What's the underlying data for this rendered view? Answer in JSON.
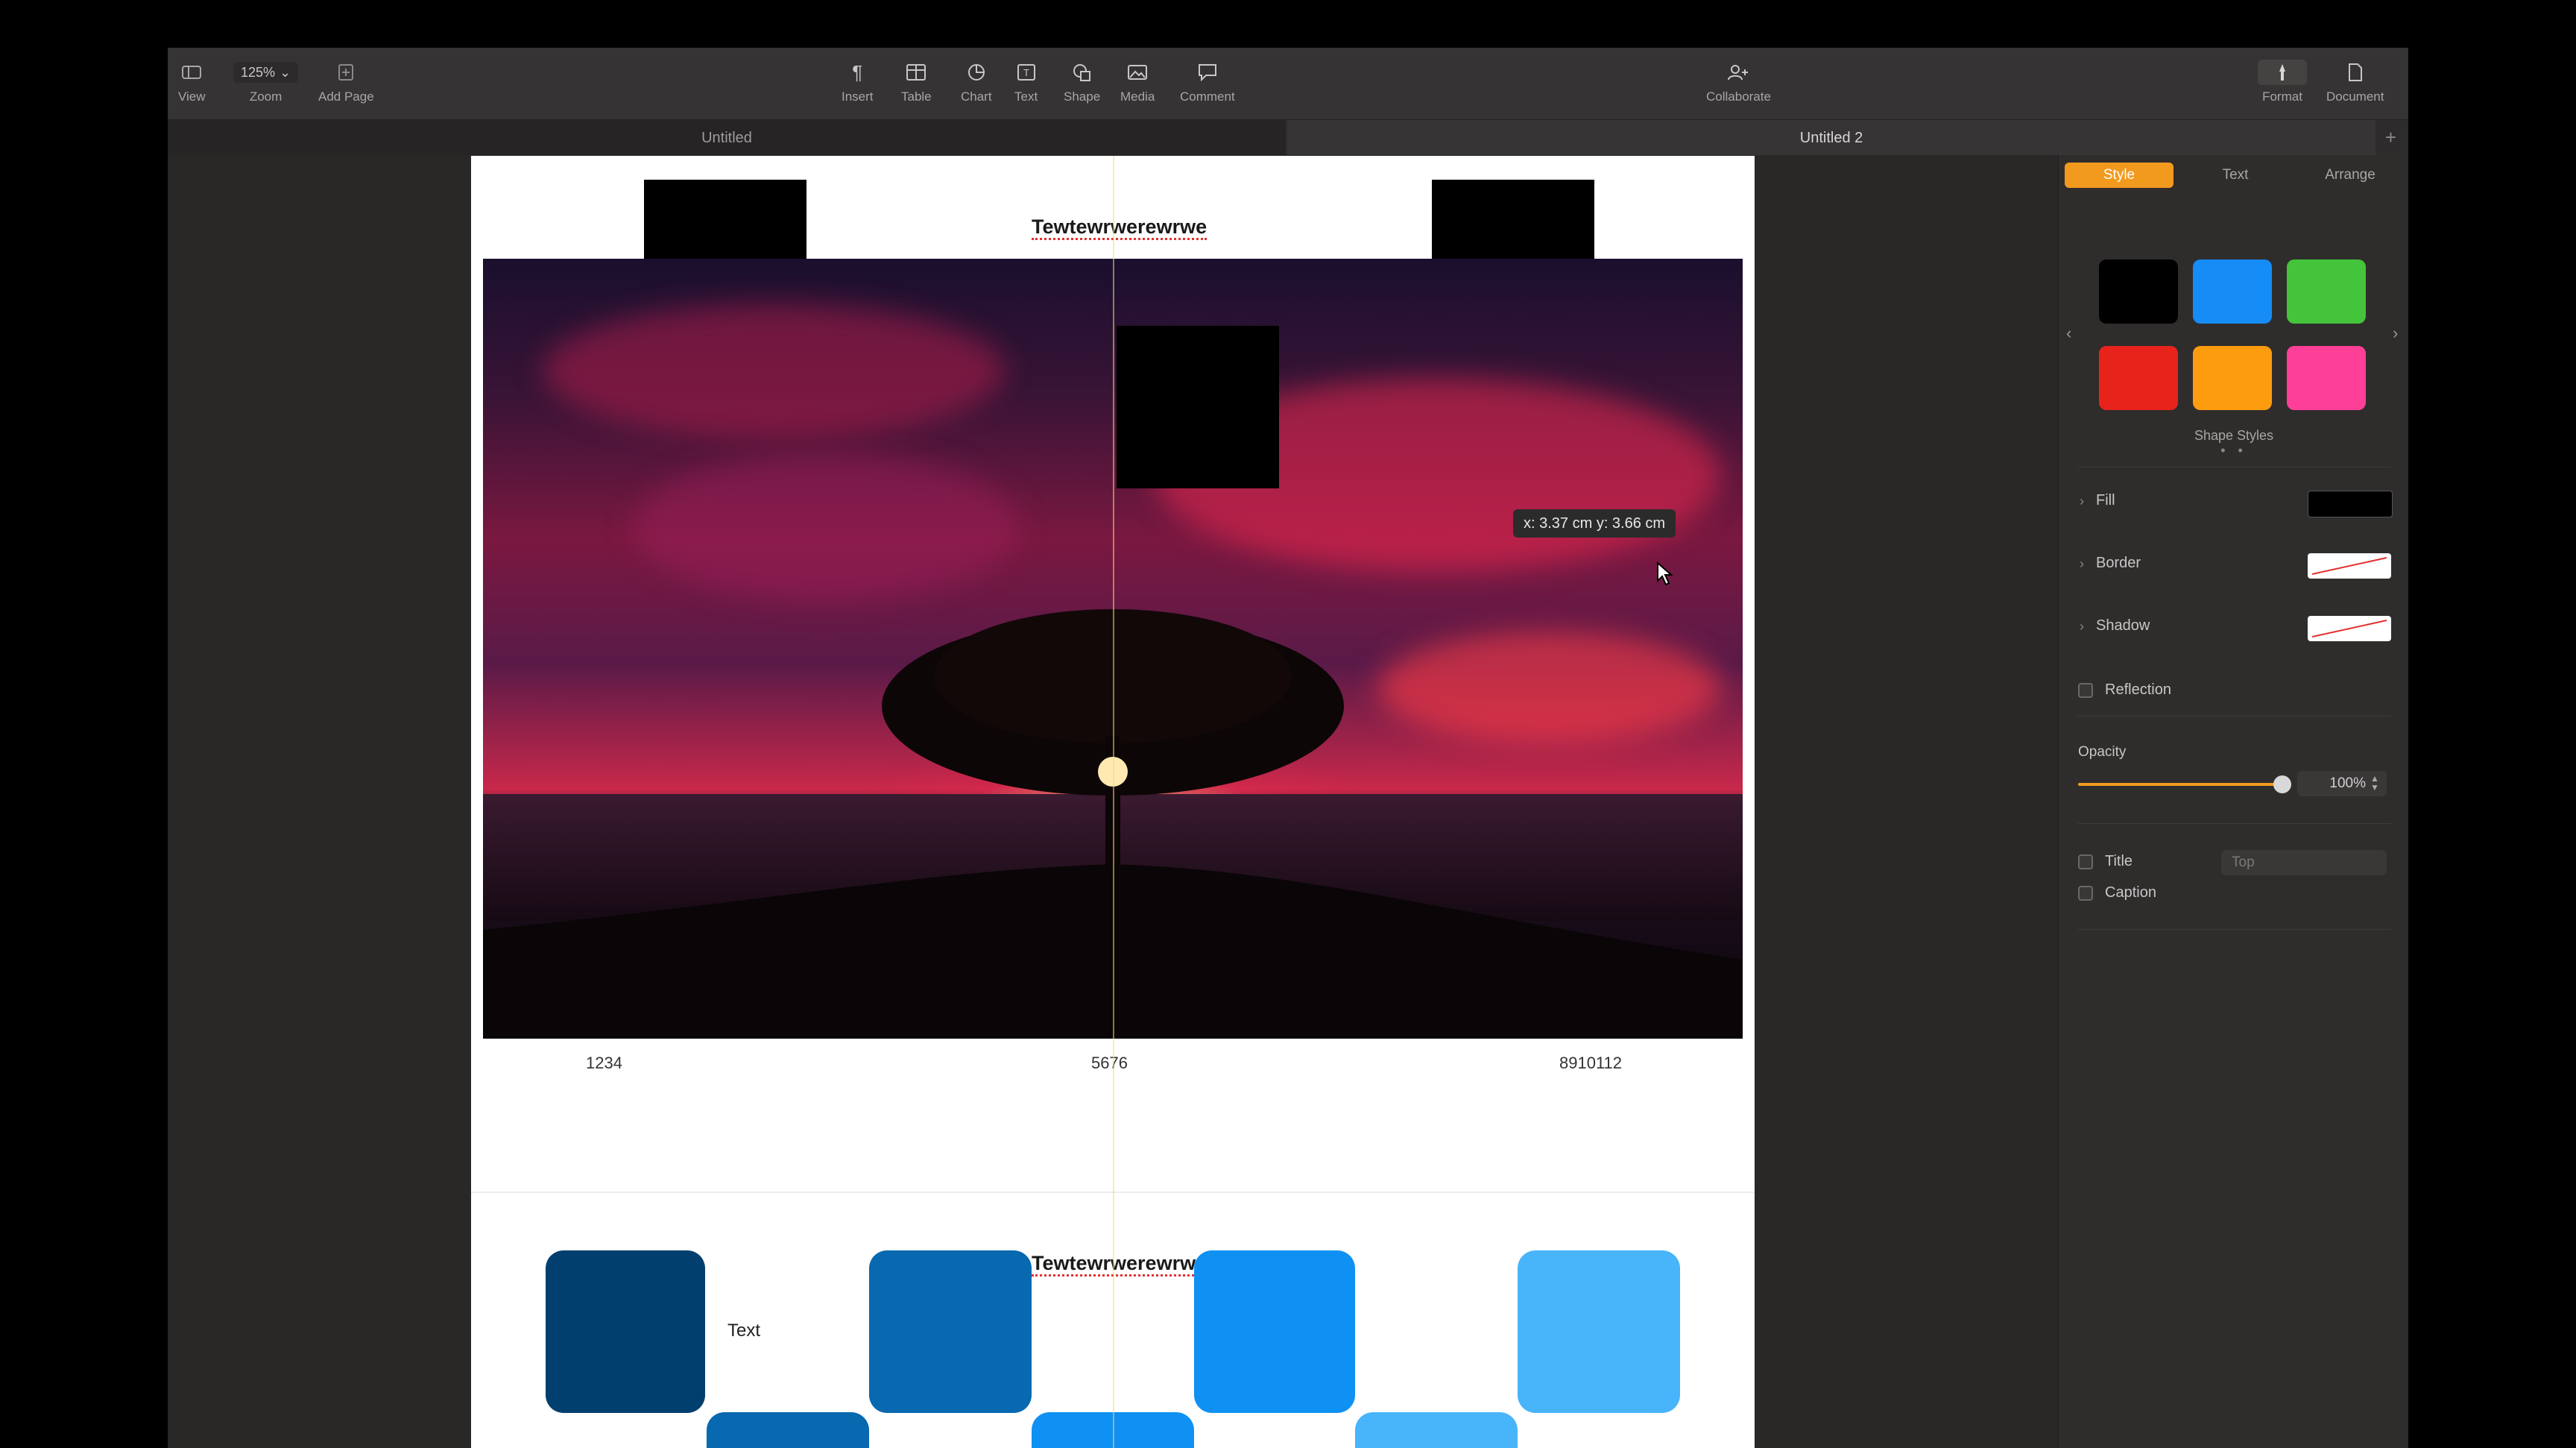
{
  "toolbar": {
    "view": {
      "label": "View",
      "icon": "sidebar-icon"
    },
    "zoom": {
      "value": "125%",
      "label": "Zoom"
    },
    "add_page": {
      "label": "Add Page",
      "icon": "add-page-icon"
    },
    "insert": {
      "label": "Insert",
      "icon": "pilcrow-icon"
    },
    "table": {
      "label": "Table",
      "icon": "table-icon"
    },
    "chart": {
      "label": "Chart",
      "icon": "chart-icon"
    },
    "text": {
      "label": "Text",
      "icon": "text-box-icon"
    },
    "shape": {
      "label": "Shape",
      "icon": "shape-icon"
    },
    "media": {
      "label": "Media",
      "icon": "media-icon"
    },
    "comment": {
      "label": "Comment",
      "icon": "comment-icon"
    },
    "collaborate": {
      "label": "Collaborate",
      "icon": "collaborate-icon"
    },
    "format": {
      "label": "Format",
      "icon": "format-brush-icon"
    },
    "document": {
      "label": "Document",
      "icon": "document-icon"
    }
  },
  "tabs": [
    {
      "label": "Untitled"
    },
    {
      "label": "Untitled 2"
    }
  ],
  "page": {
    "heading_top": "Tewtewrwerewrwe",
    "heading_bottom": "Tewtewrwerewrwe",
    "numbers": [
      "1234",
      "5676",
      "8910112"
    ],
    "coord_tip": "x: 3.37 cm  y: 3.66 cm",
    "tile_label": "Text",
    "tile_colors": [
      "#003f6e",
      "#0868b0",
      "#0e91f2",
      "#48b4fa"
    ]
  },
  "sidebar": {
    "tabs": [
      "Style",
      "Text",
      "Arrange"
    ],
    "swatch_colors": [
      "#000000",
      "#168cf6",
      "#44c43a",
      "#e8231c",
      "#fd9c0e",
      "#fd3f98"
    ],
    "shape_styles_label": "Shape Styles",
    "fill_label": "Fill",
    "border_label": "Border",
    "shadow_label": "Shadow",
    "reflection_label": "Reflection",
    "opacity_label": "Opacity",
    "opacity_value": "100%",
    "title_label": "Title",
    "title_select": "Top",
    "caption_label": "Caption",
    "accent_color": "#f29a1e"
  }
}
